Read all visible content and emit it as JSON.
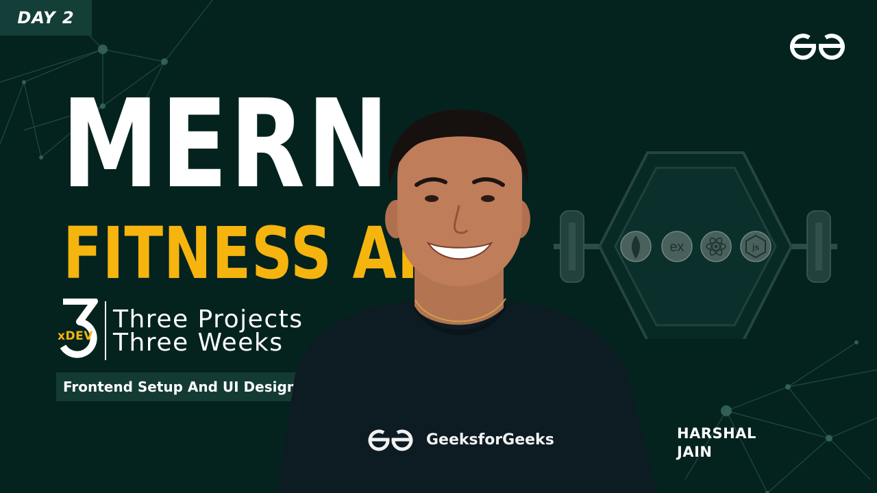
{
  "badge": {
    "day": "DAY 2"
  },
  "title": {
    "line1": "MERN",
    "line2": "FITNESS APP"
  },
  "series": {
    "numeral": "3",
    "brand": "xDEV",
    "tagline1": "Three Projects",
    "tagline2": "Three Weeks"
  },
  "topic": "Frontend Setup And UI Design",
  "shirt": {
    "text": "GeeksforGeeks"
  },
  "speaker": {
    "first": "HARSHAL",
    "last": "JAIN"
  },
  "stack_icons": [
    "mongodb-icon",
    "express-icon",
    "react-icon",
    "nodejs-icon"
  ],
  "stack_labels": {
    "express": "ex",
    "node": "js"
  },
  "colors": {
    "background": "#04231f",
    "accent": "#f6b40e",
    "text": "#ffffff",
    "badge": "#143f38",
    "shirt": "#0d1b22"
  },
  "icons": {
    "brand_logo": "gfg-logo-icon",
    "illustration": "dumbbell-hexagon-icon"
  }
}
